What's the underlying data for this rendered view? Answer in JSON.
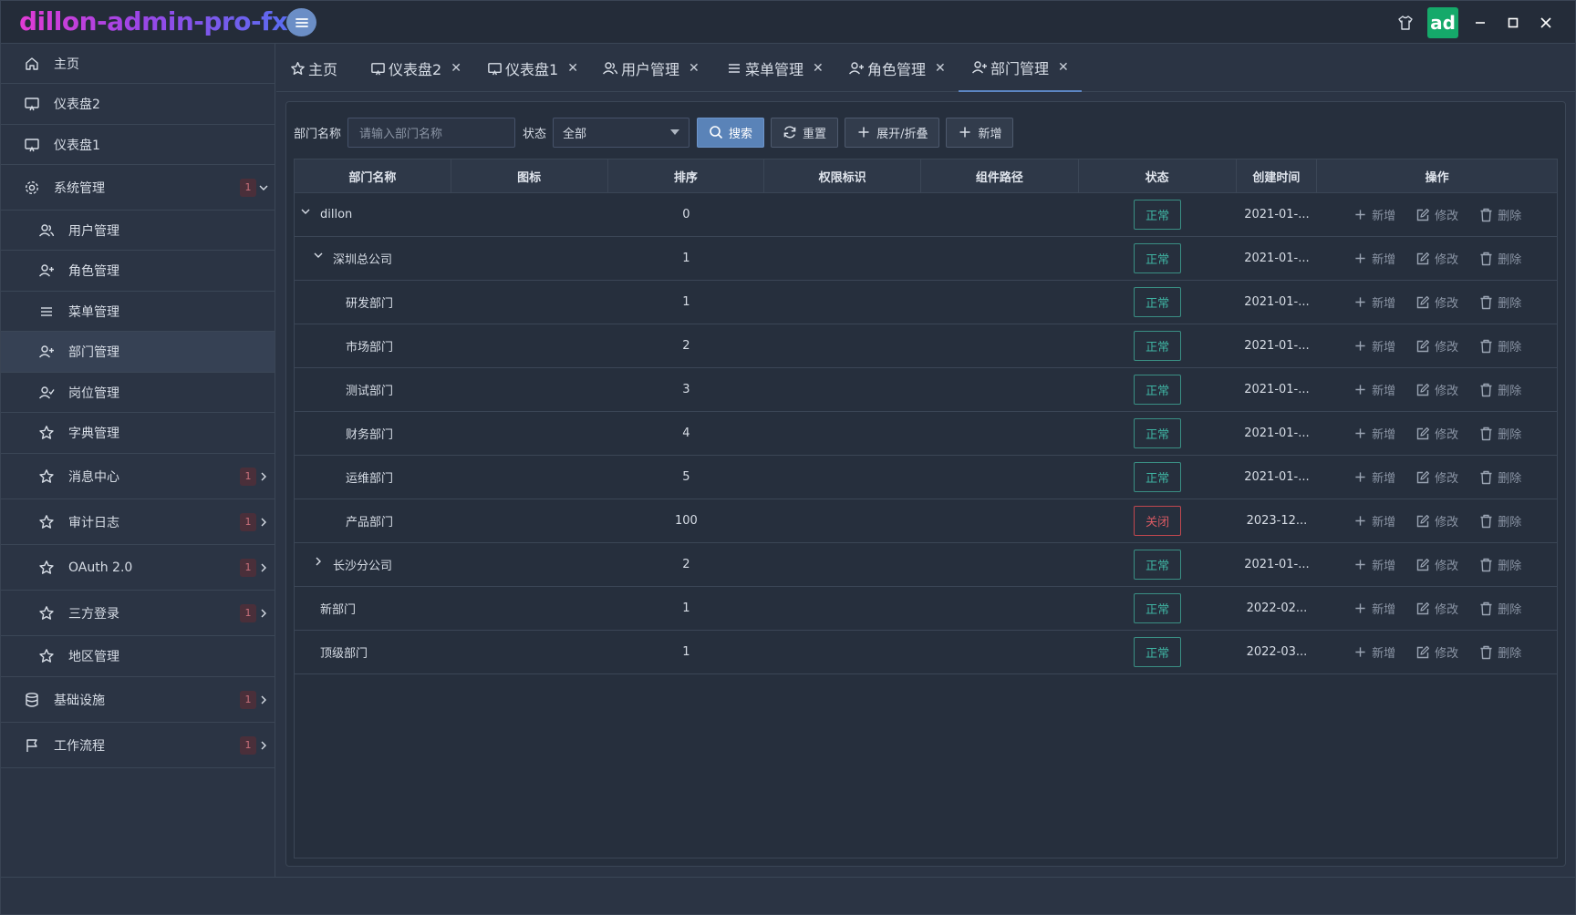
{
  "app": {
    "title": "dillon-admin-pro-fx",
    "avatar_text": "ad"
  },
  "sidebar": {
    "items": [
      {
        "label": "主页",
        "icon": "home-icon"
      },
      {
        "label": "仪表盘2",
        "icon": "monitor-icon"
      },
      {
        "label": "仪表盘1",
        "icon": "monitor-icon"
      },
      {
        "label": "系统管理",
        "icon": "gear-icon",
        "badge": "1",
        "expanded": true
      },
      {
        "label": "用户管理",
        "icon": "users-icon"
      },
      {
        "label": "角色管理",
        "icon": "user-plus-icon"
      },
      {
        "label": "菜单管理",
        "icon": "menu-icon"
      },
      {
        "label": "部门管理",
        "icon": "user-plus-icon",
        "active": true
      },
      {
        "label": "岗位管理",
        "icon": "user-check-icon"
      },
      {
        "label": "字典管理",
        "icon": "star-icon"
      },
      {
        "label": "消息中心",
        "icon": "star-icon",
        "badge": "1"
      },
      {
        "label": "审计日志",
        "icon": "star-icon",
        "badge": "1"
      },
      {
        "label": "OAuth 2.0",
        "icon": "star-icon",
        "badge": "1"
      },
      {
        "label": "三方登录",
        "icon": "star-icon",
        "badge": "1"
      },
      {
        "label": "地区管理",
        "icon": "star-icon"
      },
      {
        "label": "基础设施",
        "icon": "database-icon",
        "badge": "1"
      },
      {
        "label": "工作流程",
        "icon": "flag-icon",
        "badge": "1"
      }
    ]
  },
  "tabs": [
    {
      "label": "主页",
      "icon": "star-icon",
      "closable": false
    },
    {
      "label": "仪表盘2",
      "icon": "monitor-icon",
      "closable": true
    },
    {
      "label": "仪表盘1",
      "icon": "monitor-icon",
      "closable": true
    },
    {
      "label": "用户管理",
      "icon": "users-icon",
      "closable": true
    },
    {
      "label": "菜单管理",
      "icon": "menu-icon",
      "closable": true
    },
    {
      "label": "角色管理",
      "icon": "user-plus-icon",
      "closable": true
    },
    {
      "label": "部门管理",
      "icon": "user-plus-icon",
      "closable": true,
      "active": true
    }
  ],
  "toolbar": {
    "dept_name_label": "部门名称",
    "dept_name_placeholder": "请输入部门名称",
    "status_label": "状态",
    "status_value": "全部",
    "search_label": "搜索",
    "reset_label": "重置",
    "expand_label": "展开/折叠",
    "add_label": "新增"
  },
  "table": {
    "headers": [
      "部门名称",
      "图标",
      "排序",
      "权限标识",
      "组件路径",
      "状态",
      "创建时间",
      "操作"
    ],
    "ops": {
      "add": "新增",
      "edit": "修改",
      "delete": "删除"
    },
    "rows": [
      {
        "name": "dillon",
        "order": "0",
        "status": "正常",
        "time": "2021-01-...",
        "toggle": "expanded"
      },
      {
        "name": "深圳总公司",
        "order": "1",
        "status": "正常",
        "time": "2021-01-...",
        "toggle": "expanded"
      },
      {
        "name": "研发部门",
        "order": "1",
        "status": "正常",
        "time": "2021-01-..."
      },
      {
        "name": "市场部门",
        "order": "2",
        "status": "正常",
        "time": "2021-01-..."
      },
      {
        "name": "测试部门",
        "order": "3",
        "status": "正常",
        "time": "2021-01-..."
      },
      {
        "name": "财务部门",
        "order": "4",
        "status": "正常",
        "time": "2021-01-..."
      },
      {
        "name": "运维部门",
        "order": "5",
        "status": "正常",
        "time": "2021-01-..."
      },
      {
        "name": "产品部门",
        "order": "100",
        "status": "关闭",
        "time": "2023-12..."
      },
      {
        "name": "长沙分公司",
        "order": "2",
        "status": "正常",
        "time": "2021-01-...",
        "toggle": "collapsed"
      },
      {
        "name": "新部门",
        "order": "1",
        "status": "正常",
        "time": "2022-02..."
      },
      {
        "name": "顶级部门",
        "order": "1",
        "status": "正常",
        "time": "2022-03..."
      }
    ]
  },
  "colors": {
    "background": "#2b3444",
    "accent": "#5a83b8",
    "status_ok": "#3fb3a2",
    "status_off": "#d85a63",
    "avatar_bg": "#15a96a"
  }
}
